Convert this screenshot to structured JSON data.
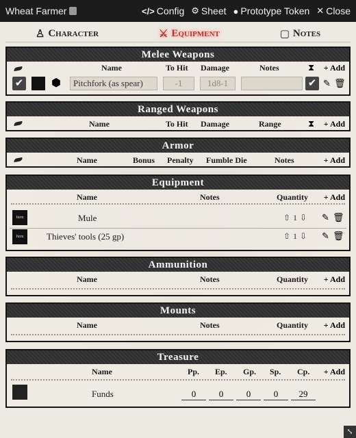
{
  "window": {
    "title": "Wheat Farmer",
    "config_label": "Config",
    "sheet_label": "Sheet",
    "token_label": "Prototype Token",
    "close_label": "Close"
  },
  "tabs": [
    {
      "label": "Character"
    },
    {
      "label": "Equipment"
    },
    {
      "label": "Notes"
    }
  ],
  "melee": {
    "heading": "Melee Weapons",
    "cols": {
      "name": "Name",
      "tohit": "To Hit",
      "damage": "Damage",
      "notes": "Notes"
    },
    "add_label": "Add",
    "weapon": {
      "name": "Pitchfork (as spear)",
      "tohit": "-1",
      "damage": "1d8-1",
      "notes": ""
    }
  },
  "ranged": {
    "heading": "Ranged Weapons",
    "cols": {
      "name": "Name",
      "tohit": "To Hit",
      "damage": "Damage",
      "range": "Range"
    },
    "add_label": "Add"
  },
  "armor": {
    "heading": "Armor",
    "cols": {
      "name": "Name",
      "bonus": "Bonus",
      "penalty": "Penalty",
      "fumble": "Fumble Die",
      "notes": "Notes"
    },
    "add_label": "Add"
  },
  "equipment": {
    "heading": "Equipment",
    "cols": {
      "name": "Name",
      "notes": "Notes",
      "quantity": "Quantity"
    },
    "add_label": "Add",
    "items": [
      {
        "name": "Mule",
        "qty": "1",
        "img_label": "Item"
      },
      {
        "name": "Thieves' tools (25 gp)",
        "qty": "1",
        "img_label": "Item"
      }
    ]
  },
  "ammunition": {
    "heading": "Ammunition",
    "cols": {
      "name": "Name",
      "notes": "Notes",
      "quantity": "Quantity"
    },
    "add_label": "Add"
  },
  "mounts": {
    "heading": "Mounts",
    "cols": {
      "name": "Name",
      "notes": "Notes",
      "quantity": "Quantity"
    },
    "add_label": "Add"
  },
  "treasure": {
    "heading": "Treasure",
    "cols": {
      "name": "Name",
      "pp": "Pp.",
      "ep": "Ep.",
      "gp": "Gp.",
      "sp": "Sp.",
      "cp": "Cp."
    },
    "add_label": "Add",
    "funds": {
      "name": "Funds",
      "pp": "0",
      "ep": "0",
      "gp": "0",
      "sp": "0",
      "cp": "29"
    }
  }
}
